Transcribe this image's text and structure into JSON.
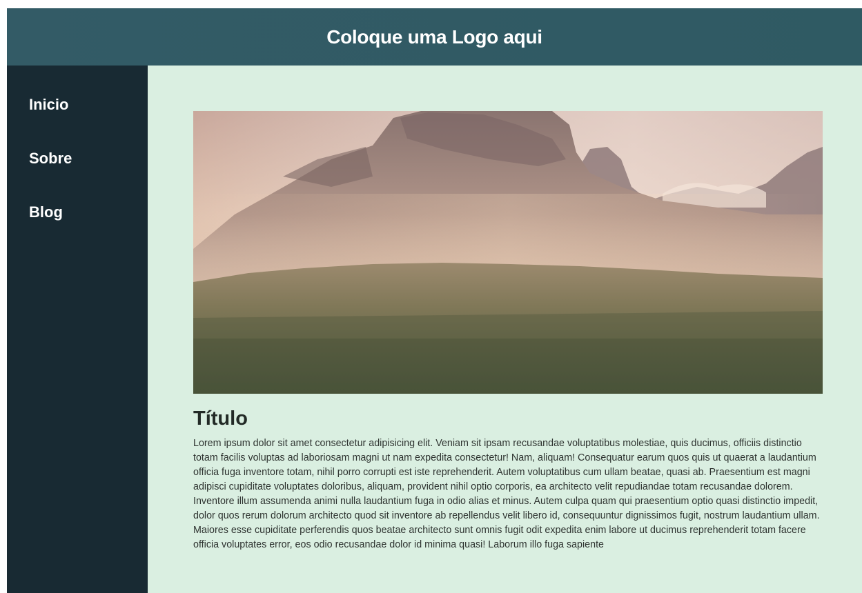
{
  "header": {
    "logo_text": "Coloque uma Logo aqui"
  },
  "sidebar": {
    "items": [
      {
        "label": "Inicio"
      },
      {
        "label": "Sobre"
      },
      {
        "label": "Blog"
      }
    ]
  },
  "main": {
    "title": "Título",
    "body": "Lorem ipsum dolor sit amet consectetur adipisicing elit. Veniam sit ipsam recusandae voluptatibus molestiae, quis ducimus, officiis distinctio totam facilis voluptas ad laboriosam magni ut nam expedita consectetur! Nam, aliquam! Consequatur earum quos quis ut quaerat a laudantium officia fuga inventore totam, nihil porro corrupti est iste reprehenderit. Autem voluptatibus cum ullam beatae, quasi ab. Praesentium est magni adipisci cupiditate voluptates doloribus, aliquam, provident nihil optio corporis, ea architecto velit repudiandae totam recusandae dolorem. Inventore illum assumenda animi nulla laudantium fuga in odio alias et minus. Autem culpa quam qui praesentium optio quasi distinctio impedit, dolor quos rerum dolorum architecto quod sit inventore ab repellendus velit libero id, consequuntur dignissimos fugit, nostrum laudantium ullam. Maiores esse cupiditate perferendis quos beatae architecto sunt omnis fugit odit expedita enim labore ut ducimus reprehenderit totam facere officia voluptates error, eos odio recusandae dolor id minima quasi! Laborum illo fuga sapiente"
  },
  "colors": {
    "header_bg": "#335b66",
    "sidebar_bg": "#182a33",
    "main_bg": "#daefe1"
  }
}
